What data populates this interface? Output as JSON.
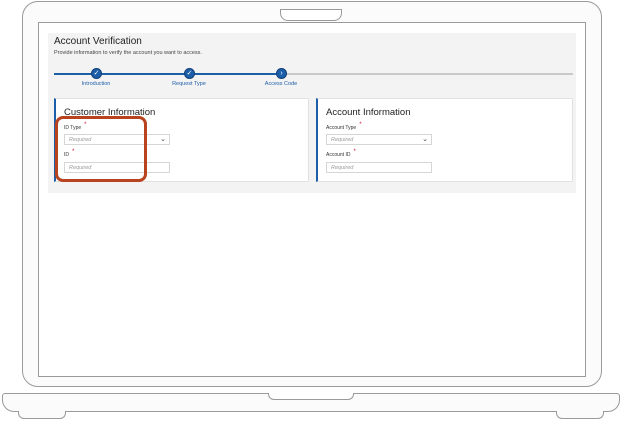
{
  "page": {
    "title": "Account Verification",
    "subtitle": "Provide information to verify the account you want to access."
  },
  "progress": {
    "steps": [
      {
        "label": "Introduction",
        "state": "complete"
      },
      {
        "label": "Request Type",
        "state": "complete"
      },
      {
        "label": "Access Code",
        "state": "current"
      }
    ]
  },
  "customer_card": {
    "title": "Customer Information",
    "fields": [
      {
        "label": "ID Type",
        "required_mark": "*",
        "placeholder": "Required",
        "type": "select"
      },
      {
        "label": "ID",
        "required_mark": "*",
        "placeholder": "Required",
        "type": "text"
      }
    ]
  },
  "account_card": {
    "title": "Account Information",
    "fields": [
      {
        "label": "Account Type",
        "required_mark": "*",
        "placeholder": "Required",
        "type": "select"
      },
      {
        "label": "Account ID",
        "required_mark": "*",
        "placeholder": "Required",
        "type": "text"
      }
    ]
  },
  "icons": {
    "check": "✓",
    "chevron_right": "›",
    "chevron_down": "⌄"
  },
  "colors": {
    "accent": "#1c5ea8",
    "required": "#c8102e",
    "highlight": "#b8431f"
  }
}
